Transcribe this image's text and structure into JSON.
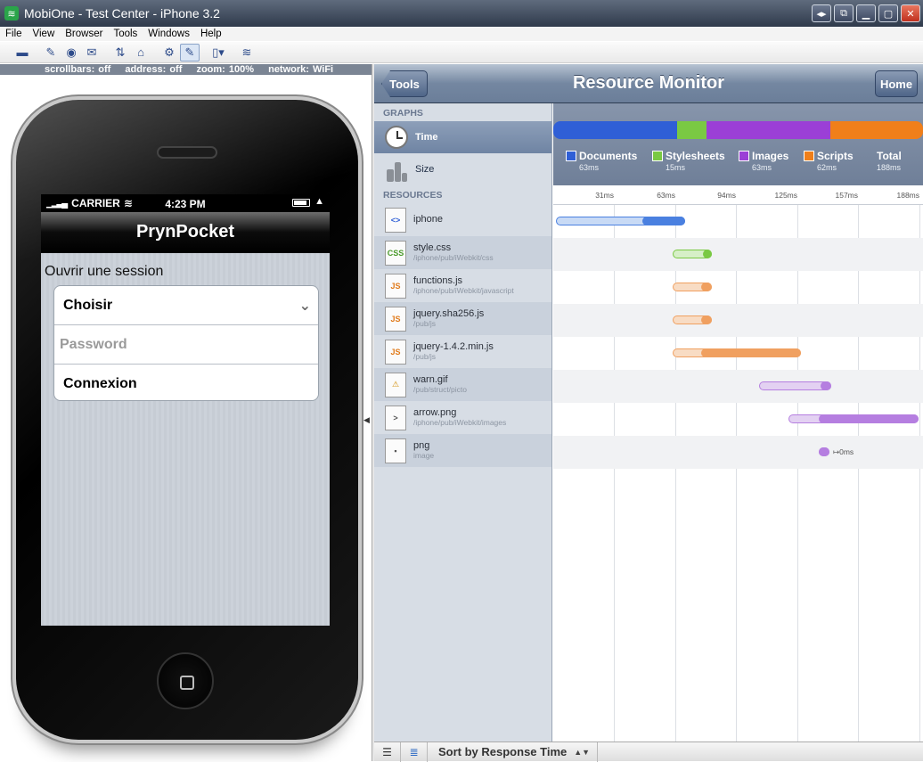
{
  "window": {
    "title": "MobiOne - Test Center - iPhone 3.2",
    "buttons": [
      "◂▸",
      "⧉",
      "▁",
      "▢",
      "✕"
    ]
  },
  "menu": [
    "File",
    "View",
    "Browser",
    "Tools",
    "Windows",
    "Help"
  ],
  "toolbar_icons": [
    "folder-icon",
    "edit-icon",
    "camera-icon",
    "mail-icon",
    "arrange-icon",
    "home-icon",
    "gear-icon",
    "wrench-icon",
    "device-icon",
    "wifi-icon"
  ],
  "device_status": {
    "scrollbars": "scrollbars: off",
    "address": "address: off",
    "zoom": "zoom: 100%",
    "network": "network: WiFi"
  },
  "phone": {
    "carrier": "CARRIER",
    "time": "4:23 PM",
    "nav_title": "PrynPocket",
    "session_label": "Ouvrir une session",
    "select_value": "Choisir",
    "password_placeholder": "Password",
    "login_button": "Connexion"
  },
  "monitor": {
    "back_button": "Tools",
    "title": "Resource Monitor",
    "home_button": "Home",
    "graphs_heading": "GRAPHS",
    "graph_items": [
      "Time",
      "Size"
    ],
    "resources_heading": "RESOURCES",
    "resources": [
      {
        "name": "iphone",
        "path": "",
        "icon": "html-icon",
        "icon_text": "<>"
      },
      {
        "name": "style.css",
        "path": "/iphone/pub/iWebkit/css",
        "icon": "css-icon",
        "icon_text": "CSS"
      },
      {
        "name": "functions.js",
        "path": "/iphone/pub/iWebkit/javascript",
        "icon": "js-icon",
        "icon_text": "JS"
      },
      {
        "name": "jquery.sha256.js",
        "path": "/pub/js",
        "icon": "js-icon",
        "icon_text": "JS"
      },
      {
        "name": "jquery-1.4.2.min.js",
        "path": "/pub/js",
        "icon": "js-icon",
        "icon_text": "JS"
      },
      {
        "name": "warn.gif",
        "path": "/pub/struct/picto",
        "icon": "warning-icon",
        "icon_text": "⚠"
      },
      {
        "name": "arrow.png",
        "path": "/iphone/pub/iWebkit/images",
        "icon": "arrow-image-icon",
        "icon_text": ">"
      },
      {
        "name": "png",
        "path": "image",
        "icon": "image-icon",
        "icon_text": "▪"
      }
    ],
    "legend": [
      {
        "label": "Documents",
        "value": "63ms",
        "color": "#2f5fd6"
      },
      {
        "label": "Stylesheets",
        "value": "15ms",
        "color": "#7ac943"
      },
      {
        "label": "Images",
        "value": "63ms",
        "color": "#9b3fd6"
      },
      {
        "label": "Scripts",
        "value": "62ms",
        "color": "#f07f1a"
      },
      {
        "label": "Total",
        "value": "188ms",
        "color": ""
      }
    ],
    "ticks": [
      "31ms",
      "63ms",
      "94ms",
      "125ms",
      "157ms",
      "188ms"
    ],
    "last_bar_label": "0ms",
    "sort_label": "Sort by Response Time"
  }
}
